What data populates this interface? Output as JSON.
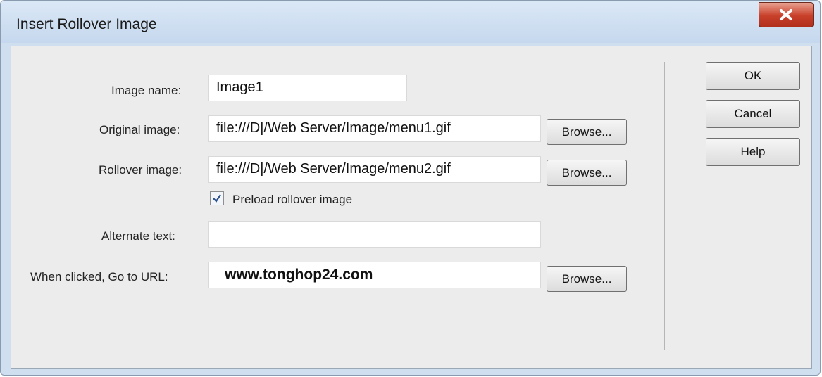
{
  "window": {
    "title": "Insert Rollover Image",
    "close_icon": "close-icon"
  },
  "form": {
    "image_name": {
      "label": "Image name:",
      "value": "Image1"
    },
    "original_image": {
      "label": "Original image:",
      "value": "file:///D|/Web Server/Image/menu1.gif",
      "browse_label": "Browse..."
    },
    "rollover_image": {
      "label": "Rollover image:",
      "value": "file:///D|/Web Server/Image/menu2.gif",
      "browse_label": "Browse..."
    },
    "preload": {
      "label": "Preload rollover image",
      "checked": true
    },
    "alternate_text": {
      "label": "Alternate text:",
      "value": ""
    },
    "url": {
      "label": "When clicked, Go to URL:",
      "value": "www.tonghop24.com",
      "browse_label": "Browse..."
    }
  },
  "buttons": {
    "ok": "OK",
    "cancel": "Cancel",
    "help": "Help"
  }
}
